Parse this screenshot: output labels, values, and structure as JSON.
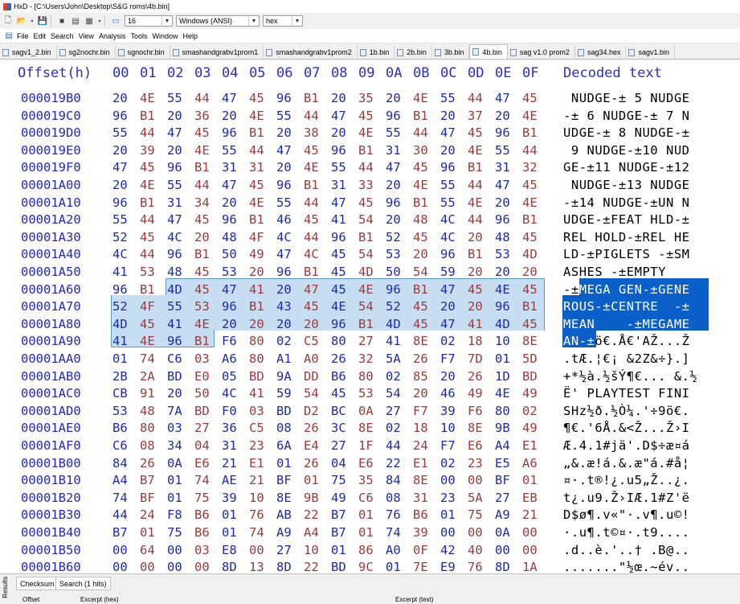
{
  "window": {
    "title": "HxD - [C:\\Users\\John\\Desktop\\S&G roms\\4b.bin]"
  },
  "toolbar": {
    "bytes_per_row": "16",
    "charset": "Windows (ANSI)",
    "offset_base": "hex"
  },
  "menu": [
    "File",
    "Edit",
    "Search",
    "View",
    "Analysis",
    "Tools",
    "Window",
    "Help"
  ],
  "tabs": [
    {
      "label": "sagv1_2.bin",
      "active": false
    },
    {
      "label": "sg2nochr.bin",
      "active": false
    },
    {
      "label": "sgnochr.bin",
      "active": false
    },
    {
      "label": "smashandgrabv1prom1",
      "active": false
    },
    {
      "label": "smashandgrabv1prom2",
      "active": false
    },
    {
      "label": "1b.bin",
      "active": false
    },
    {
      "label": "2b.bin",
      "active": false
    },
    {
      "label": "3b.bin",
      "active": false
    },
    {
      "label": "4b.bin",
      "active": true
    },
    {
      "label": "sag v1.0 prom2",
      "active": false
    },
    {
      "label": "sag34.hex",
      "active": false
    },
    {
      "label": "sagv1.bin",
      "active": false
    }
  ],
  "header": {
    "offset_label": "Offset(h)",
    "columns": "00 01 02 03 04 05 06 07 08 09 0A 0B 0C 0D 0E 0F",
    "decoded_label": "Decoded text"
  },
  "rows": [
    {
      "offset": "000019B0",
      "bytes": "20 4E 55 44 47 45 96 B1 20 35 20 4E 55 44 47 45",
      "text": " NUDGE-± 5 NUDGE"
    },
    {
      "offset": "000019C0",
      "bytes": "96 B1 20 36 20 4E 55 44 47 45 96 B1 20 37 20 4E",
      "text": "-± 6 NUDGE-± 7 N"
    },
    {
      "offset": "000019D0",
      "bytes": "55 44 47 45 96 B1 20 38 20 4E 55 44 47 45 96 B1",
      "text": "UDGE-± 8 NUDGE-±"
    },
    {
      "offset": "000019E0",
      "bytes": "20 39 20 4E 55 44 47 45 96 B1 31 30 20 4E 55 44",
      "text": " 9 NUDGE-±10 NUD"
    },
    {
      "offset": "000019F0",
      "bytes": "47 45 96 B1 31 31 20 4E 55 44 47 45 96 B1 31 32",
      "text": "GE-±11 NUDGE-±12"
    },
    {
      "offset": "00001A00",
      "bytes": "20 4E 55 44 47 45 96 B1 31 33 20 4E 55 44 47 45",
      "text": " NUDGE-±13 NUDGE"
    },
    {
      "offset": "00001A10",
      "bytes": "96 B1 31 34 20 4E 55 44 47 45 96 B1 55 4E 20 4E",
      "text": "-±14 NUDGE-±UN N"
    },
    {
      "offset": "00001A20",
      "bytes": "55 44 47 45 96 B1 46 45 41 54 20 48 4C 44 96 B1",
      "text": "UDGE-±FEAT HLD-±"
    },
    {
      "offset": "00001A30",
      "bytes": "52 45 4C 20 48 4F 4C 44 96 B1 52 45 4C 20 48 45",
      "text": "REL HOLD-±REL HE"
    },
    {
      "offset": "00001A40",
      "bytes": "4C 44 96 B1 50 49 47 4C 45 54 53 20 96 B1 53 4D",
      "text": "LD-±PIGLETS -±SM"
    },
    {
      "offset": "00001A50",
      "bytes": "41 53 48 45 53 20 96 B1 45 4D 50 54 59 20 20 20",
      "text": "ASHES -±EMPTY   "
    },
    {
      "offset": "00001A60",
      "bytes": "96 B1 4D 45 47 41 20 47 45 4E 96 B1 47 45 4E 45",
      "text": "-±MEGA GEN-±GENE"
    },
    {
      "offset": "00001A70",
      "bytes": "52 4F 55 53 96 B1 43 45 4E 54 52 45 20 20 96 B1",
      "text": "ROUS-±CENTRE  -±"
    },
    {
      "offset": "00001A80",
      "bytes": "4D 45 41 4E 20 20 20 96 B1 4D 45 47 41 4D 45",
      "text": "MEAN    -±MEGAME",
      "note_bytes_full": "4D 45 41 4E 20 20 20 20 96 B1 4D 45 47 41 4D 45"
    },
    {
      "offset": "00001A90",
      "bytes": "41 4E 96 B1 F6 80 02 C5 80 27 41 8E 02 18 10 8E",
      "text": "AN-±ö€.Å€'AŽ...Ž"
    },
    {
      "offset": "00001AA0",
      "bytes": "01 74 C6 03 A6 80 A1 A0 26 32 5A 26 F7 7D 01 5D",
      "text": ".tÆ.¦€¡ &2Z&÷}.]"
    },
    {
      "offset": "00001AB0",
      "bytes": "2B 2A BD E0 05 BD 9A DD B6 80 02 85 20 26 1D BD",
      "text": "+*½à.½šÝ¶€... &.½"
    },
    {
      "offset": "00001AC0",
      "bytes": "CB 91 20 50 4C 41 59 54 45 53 54 20 46 49 4E 49",
      "text": "Ë' PLAYTEST FINI"
    },
    {
      "offset": "00001AD0",
      "bytes": "53 48 7A BD F0 03 BD D2 BC 0A 27 F7 39 F6 80 02",
      "text": "SHz½ð.½Ò¼.'÷9ö€."
    },
    {
      "offset": "00001AE0",
      "bytes": "B6 80 03 27 36 C5 08 26 3C 8E 02 18 10 8E 9B 49",
      "text": "¶€.'6Å.&<Ž...Ž›I"
    },
    {
      "offset": "00001AF0",
      "bytes": "C6 08 34 04 31 23 6A E4 27 1F 44 24 F7 E6 A4 E1",
      "text": "Æ.4.1#jä'.D$÷æ¤á"
    },
    {
      "offset": "00001B00",
      "bytes": "84 26 0A E6 21 E1 01 26 04 E6 22 E1 02 23 E5 A6",
      "text": "„&.æ!á.&.æ\"á.#å¦"
    },
    {
      "offset": "00001B10",
      "bytes": "A4 B7 01 74 AE 21 BF 01 75 35 84 8E 00 00 BF 01",
      "text": "¤·.t®!¿.u5„Ž..¿."
    },
    {
      "offset": "00001B20",
      "bytes": "74 BF 01 75 39 10 8E 9B 49 C6 08 31 23 5A 27 EB",
      "text": "t¿.u9.Ž›IÆ.1#Z'ë"
    },
    {
      "offset": "00001B30",
      "bytes": "44 24 F8 B6 01 76 AB 22 B7 01 76 B6 01 75 A9 21",
      "text": "D$ø¶.v«\"·.v¶.u©!"
    },
    {
      "offset": "00001B40",
      "bytes": "B7 01 75 B6 01 74 A9 A4 B7 01 74 39 00 00 0A 00",
      "text": "·.u¶.t©¤·.t9...."
    },
    {
      "offset": "00001B50",
      "bytes": "00 64 00 03 E8 00 27 10 01 86 A0 0F 42 40 00 00",
      "text": ".d..è.'..† .B@.."
    },
    {
      "offset": "00001B60",
      "bytes": "00 00 00 00 8D 13 8D 22 BD 9C 01 7E E9 76 8D 1A",
      "text": ".......\"½œ.~év.."
    }
  ],
  "bottom_tabs": [
    "Checksum",
    "Search (1 hits)"
  ],
  "results_label": "Results",
  "result_columns": [
    "Offset",
    "Excerpt (hex)",
    "Excerpt (text)"
  ],
  "colors": {
    "offset": "#2626c8",
    "even_byte": "#1e2aa8",
    "odd_byte": "#9b3b3b",
    "selection_hex": "#c7ddf2",
    "selection_text": "#0a5fc8"
  }
}
